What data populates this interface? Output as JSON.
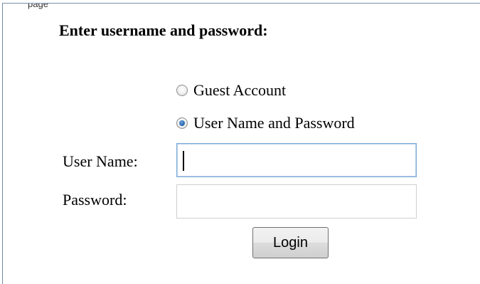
{
  "page": {
    "top_label": "page"
  },
  "form": {
    "heading": "Enter username and password:",
    "options": {
      "guest_label": "Guest Account",
      "user_label": "User Name and Password",
      "selected": "User Name and Password"
    },
    "fields": {
      "username_label": "User Name:",
      "username_value": "",
      "password_label": "Password:",
      "password_value": ""
    },
    "login_label": "Login"
  }
}
